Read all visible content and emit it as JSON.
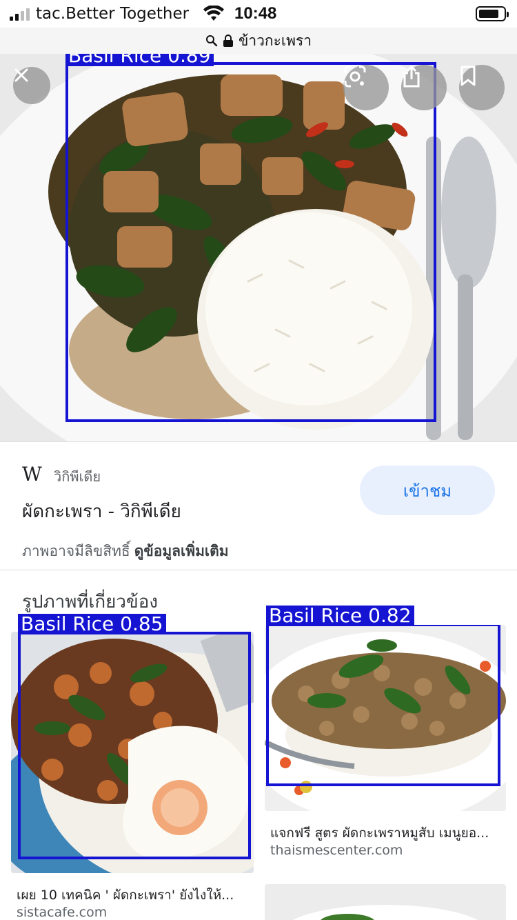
{
  "status_bar": {
    "carrier": "tac.Better Together",
    "time": "10:48"
  },
  "url_bar": {
    "query": "ข้าวกะเพรา"
  },
  "hero": {
    "detection": {
      "label": "Basil Rice 0.89"
    }
  },
  "source_card": {
    "logo_letter": "W",
    "source_name": "วิกิพีเดีย",
    "title": "ผัดกะเพรา - วิกิพีเดีย",
    "visit_label": "เข้าชม",
    "copyright_text": "ภาพอาจมีลิขสิทธิ์",
    "more_info_link": "ดูข้อมูลเพิ่มเติม"
  },
  "related": {
    "heading": "รูปภาพที่เกี่ยวข้อง",
    "items": [
      {
        "detection": "Basil Rice 0.85",
        "caption": "เผย 10 เทคนิค ' ผัดกะเพรา' ยังไงให้...",
        "domain": "sistacafe.com"
      },
      {
        "detection": "Basil Rice 0.82",
        "caption": "แจกฟรี สูตร ผัดกะเพราหมูสับ เมนูยอ...",
        "domain": "thaismescenter.com"
      }
    ]
  },
  "colors": {
    "detection_box": "#1414d2",
    "visit_button_bg": "#e8f0fe",
    "visit_button_text": "#1a73e8"
  },
  "icons": [
    "close-icon",
    "lens-icon",
    "share-icon",
    "bookmark-icon",
    "wifi-icon",
    "lock-icon",
    "wikipedia-logo"
  ]
}
